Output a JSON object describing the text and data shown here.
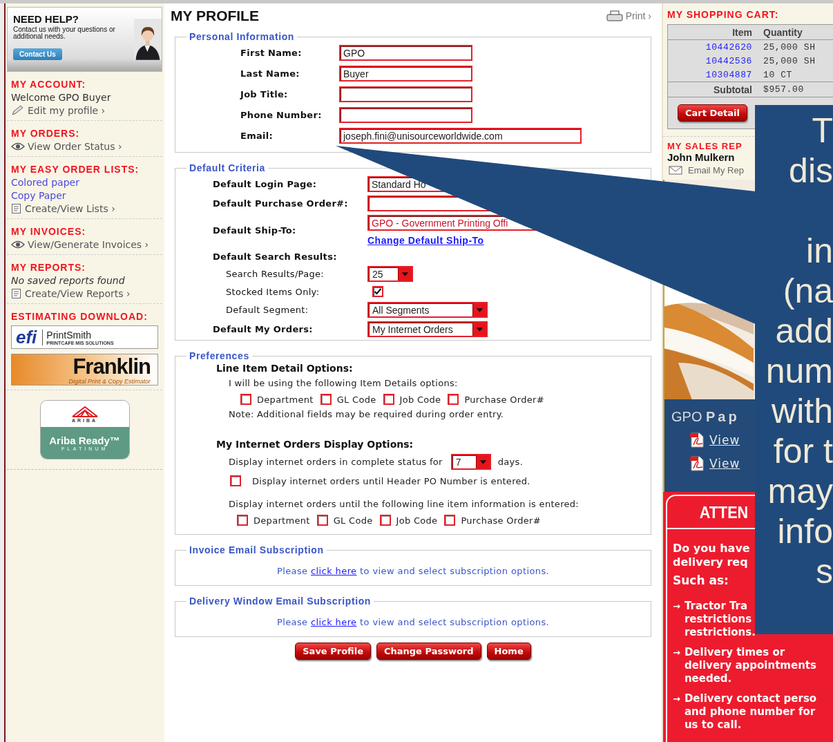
{
  "help_banner": {
    "title": "NEED HELP?",
    "text": "Contact us with your questions or additional needs.",
    "button": "Contact Us"
  },
  "sidebar_sections": [
    {
      "heading": "MY ACCOUNT:",
      "items": [
        {
          "kind": "text",
          "text": "Welcome GPO Buyer"
        },
        {
          "kind": "edit_link",
          "text": "Edit my profile ›"
        }
      ]
    },
    {
      "heading": "MY ORDERS:",
      "items": [
        {
          "kind": "view_link",
          "text": "View Order Status ›"
        }
      ]
    },
    {
      "heading": "MY EASY ORDER LISTS:",
      "items": [
        {
          "kind": "link",
          "text": "Colored paper"
        },
        {
          "kind": "link",
          "text": "Copy Paper"
        },
        {
          "kind": "list_link",
          "text": "Create/View Lists ›"
        }
      ]
    },
    {
      "heading": "MY INVOICES:",
      "items": [
        {
          "kind": "view_link",
          "text": "View/Generate Invoices ›"
        }
      ]
    },
    {
      "heading": "MY REPORTS:",
      "items": [
        {
          "kind": "note",
          "text": "No saved reports found"
        },
        {
          "kind": "list_link",
          "text": "Create/View Reports ›"
        }
      ]
    },
    {
      "heading": "ESTIMATING DOWNLOAD:",
      "items": [
        {
          "kind": "efi_logo",
          "mark": "efi",
          "text": "PrintSmith",
          "tagline": "PRINTCAFE MIS SOLUTIONS"
        },
        {
          "kind": "franklin_logo",
          "text": "Franklin",
          "tagline": "Digital Print & Copy Estimator"
        }
      ]
    }
  ],
  "ariba_badge": {
    "brand": "ARIBA",
    "title": "Ariba Ready™",
    "tier": "PLATINUM"
  },
  "page_title": "MY PROFILE",
  "print_link": "Print ›",
  "personal_information": {
    "legend": "Personal Information",
    "fields": [
      {
        "kind": "input",
        "label": "First Name:",
        "value": "GPO"
      },
      {
        "kind": "input",
        "label": "Last Name:",
        "value": "Buyer"
      },
      {
        "kind": "input",
        "label": "Job Title:"
      },
      {
        "kind": "input",
        "label": "Phone Number:"
      },
      {
        "kind": "wide_input",
        "label": "Email:",
        "value": "joseph.fini@unisourceworldwide.com"
      }
    ]
  },
  "default_criteria": {
    "legend": "Default Criteria",
    "rows": [
      {
        "kind": "input",
        "label": "Default Login Page:",
        "value": "Standard Ho"
      },
      {
        "kind": "input",
        "label": "Default Purchase Order#:"
      },
      {
        "kind": "input",
        "label": "Default Ship-To:",
        "value": "GPO - Government Printing Offi",
        "color": "#d0102a",
        "link": "Change Default Ship-To"
      },
      {
        "kind": "heading",
        "label": "Default Search Results:"
      },
      {
        "kind": "select_small",
        "label": "Search Results/Page:",
        "value": "25",
        "sub": true
      },
      {
        "kind": "checkbox",
        "label": "Stocked Items Only:",
        "checked": true,
        "sub": true
      },
      {
        "kind": "select",
        "label": "Default Segment:",
        "value": "All Segments",
        "sub": true
      },
      {
        "kind": "select",
        "label": "Default My Orders:",
        "value": "My Internet Orders",
        "sub": false
      }
    ]
  },
  "preferences": {
    "legend": "Preferences",
    "line_item": {
      "heading": "Line Item Detail Options:",
      "intro": "I will be using the following Item Details options:",
      "options": [
        {
          "label": "Department",
          "checked": false
        },
        {
          "label": "GL Code",
          "checked": false
        },
        {
          "label": "Job Code",
          "checked": false
        },
        {
          "label": "Purchase Order#",
          "checked": false
        }
      ],
      "note": "Note: Additional fields may be required during order entry."
    },
    "orders_display": {
      "heading": "My Internet Orders Display Options:",
      "days_before": "Display internet orders in complete status for",
      "days_value": "7",
      "days_after": "days.",
      "header_po": {
        "label": "Display internet orders until Header PO Number is entered.",
        "checked": false
      },
      "line_intro": "Display internet orders until the following line item information is entered:",
      "options": [
        {
          "label": "Department",
          "checked": false
        },
        {
          "label": "GL Code",
          "checked": false
        },
        {
          "label": "Job Code",
          "checked": false
        },
        {
          "label": "Purchase Order#",
          "checked": false
        }
      ]
    }
  },
  "subscriptions": [
    {
      "legend": "Invoice Email Subscription",
      "before": "Please",
      "link": "click here",
      "after": "to view and select subscription options."
    },
    {
      "legend": "Delivery Window Email Subscription",
      "before": "Please",
      "link": "click here",
      "after": "to view and select subscription options."
    }
  ],
  "buttons": [
    "Save Profile",
    "Change Password",
    "Home"
  ],
  "cart": {
    "heading": "MY SHOPPING CART:",
    "columns": [
      "Item",
      "Quantity"
    ],
    "rows": [
      {
        "item": "10442620",
        "quantity": "25,000 SH"
      },
      {
        "item": "10442536",
        "quantity": "25,000 SH"
      },
      {
        "item": "10304887",
        "quantity": "10 CT"
      }
    ],
    "subtotal_label": "Subtotal",
    "subtotal": "$957.00",
    "button": "Cart Detail"
  },
  "sales_rep": {
    "heading": "MY SALES REP",
    "name": "John Mulkern",
    "link": "Email My Rep"
  },
  "promo": {
    "kind": "picture"
  },
  "gpo_panel": {
    "title_light": "GPO",
    "title_bold": "Pap",
    "links": [
      "View",
      "View"
    ]
  },
  "attention": {
    "heading": "ATTEN",
    "question": [
      "Do you have",
      "delivery req"
    ],
    "lead": "Such as:",
    "bullets": [
      {
        "marker": "→",
        "lines": [
          "Tractor Tra",
          "restrictions",
          "restrictions."
        ]
      },
      {
        "marker": "→",
        "lines": [
          "Delivery times or",
          "delivery appointments",
          "needed."
        ]
      },
      {
        "marker": "→",
        "lines": [
          "Delivery contact perso",
          "and phone number for",
          "us to call."
        ]
      }
    ]
  },
  "callout": {
    "lines": [
      {
        "text": "T"
      },
      {
        "text": "dis"
      },
      {
        "text": "in",
        "gap_before": true
      },
      {
        "text": "(na"
      },
      {
        "text": "add"
      },
      {
        "text": "num"
      },
      {
        "text": "with"
      },
      {
        "text": "for t"
      },
      {
        "text": "may"
      },
      {
        "text": "info"
      },
      {
        "text": "s"
      }
    ]
  }
}
